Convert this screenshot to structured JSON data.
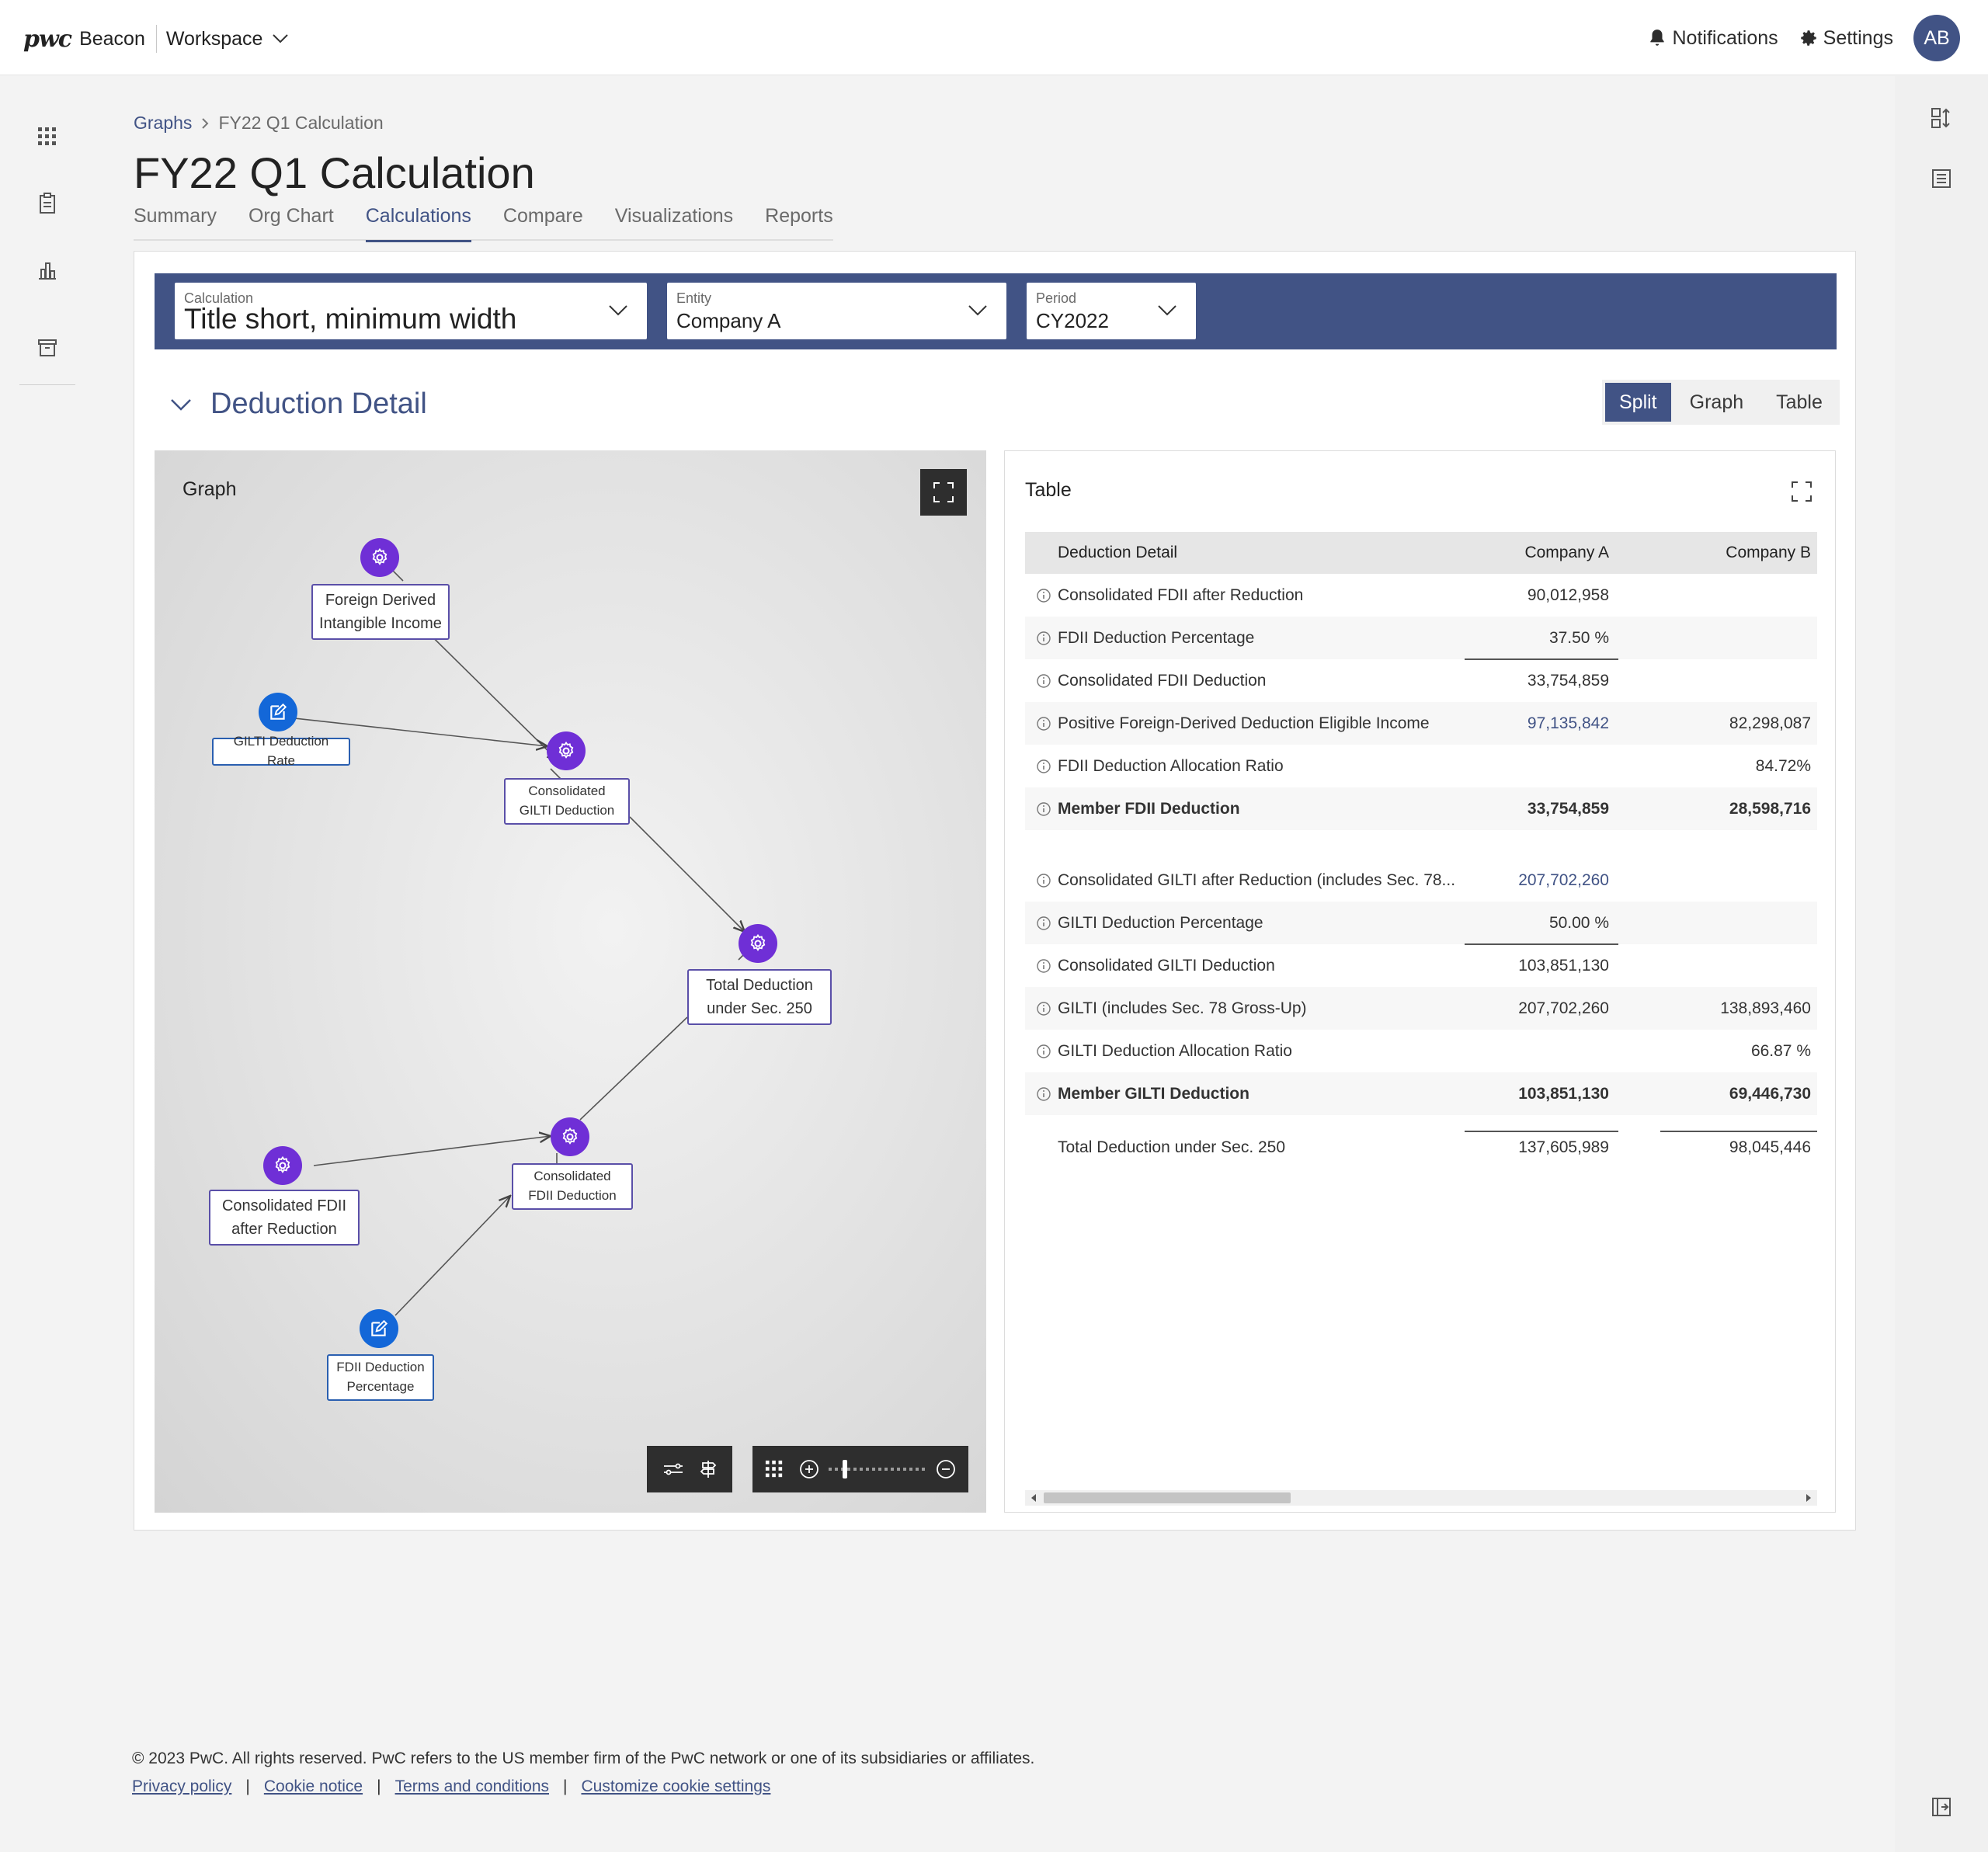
{
  "app": {
    "logo_text": "pwc",
    "product": "Beacon",
    "workspace_label": "Workspace",
    "notifications_label": "Notifications",
    "settings_label": "Settings",
    "avatar_initials": "AB"
  },
  "breadcrumb": {
    "parent": "Graphs",
    "current": "FY22 Q1 Calculation"
  },
  "page_title": "FY22 Q1 Calculation",
  "tabs": [
    "Summary",
    "Org Chart",
    "Calculations",
    "Compare",
    "Visualizations",
    "Reports"
  ],
  "active_tab": "Calculations",
  "filters": {
    "calculation": {
      "label": "Calculation",
      "value": "Title short, minimum width"
    },
    "entity": {
      "label": "Entity",
      "value": "Company A"
    },
    "period": {
      "label": "Period",
      "value": "CY2022"
    }
  },
  "section": {
    "title": "Deduction Detail",
    "view_modes": [
      "Split",
      "Graph",
      "Table"
    ],
    "active_view": "Split"
  },
  "graph": {
    "title": "Graph",
    "nodes": {
      "fdii_income": "Foreign Derived Intangible Income",
      "gilti_rate": "GILTI Deduction Rate",
      "cons_gilti_ded": "Consolidated GILTI Deduction",
      "total_ded": "Total Deduction under Sec. 250",
      "cons_fdii_after": "Consolidated FDII after Reduction",
      "cons_fdii_ded": "Consolidated FDII Deduction",
      "fdii_pct": "FDII Deduction Percentage"
    }
  },
  "table": {
    "title": "Table",
    "headers": {
      "label": "Deduction Detail",
      "a": "Company A",
      "b": "Company B"
    },
    "rows1": [
      {
        "label": "Consolidated FDII after Reduction",
        "a": "90,012,958",
        "b": ""
      },
      {
        "label": "FDII Deduction Percentage",
        "a": "37.50 %",
        "b": ""
      },
      {
        "label": "Consolidated FDII Deduction",
        "a": "33,754,859",
        "b": ""
      },
      {
        "label": "Positive Foreign-Derived Deduction Eligible Income",
        "a": "97,135,842",
        "b": "82,298,087"
      },
      {
        "label": "FDII Deduction Allocation Ratio",
        "a": "",
        "b": "84.72%"
      },
      {
        "label": "Member FDII Deduction",
        "a": "33,754,859",
        "b": "28,598,716"
      }
    ],
    "rows2": [
      {
        "label": "Consolidated GILTI after Reduction (includes Sec. 78...",
        "a": "207,702,260",
        "b": ""
      },
      {
        "label": "GILTI Deduction Percentage",
        "a": "50.00 %",
        "b": ""
      },
      {
        "label": "Consolidated GILTI Deduction",
        "a": "103,851,130",
        "b": ""
      },
      {
        "label": "GILTI (includes Sec. 78 Gross-Up)",
        "a": "207,702,260",
        "b": "138,893,460"
      },
      {
        "label": "GILTI Deduction Allocation Ratio",
        "a": "",
        "b": "66.87 %"
      },
      {
        "label": "Member GILTI Deduction",
        "a": "103,851,130",
        "b": "69,446,730"
      }
    ],
    "total": {
      "label": "Total Deduction under Sec. 250",
      "a": "137,605,989",
      "b": "98,045,446"
    }
  },
  "footer": {
    "copyright": "© 2023 PwC. All rights reserved. PwC refers to the US member firm of the PwC network or one of its subsidiaries or affiliates.",
    "links": [
      "Privacy policy",
      "Cookie notice",
      "Terms and conditions",
      "Customize cookie settings"
    ]
  },
  "colors": {
    "primary": "#415385",
    "calc_node": "#6f2fd6",
    "input_node": "#1367d8"
  }
}
